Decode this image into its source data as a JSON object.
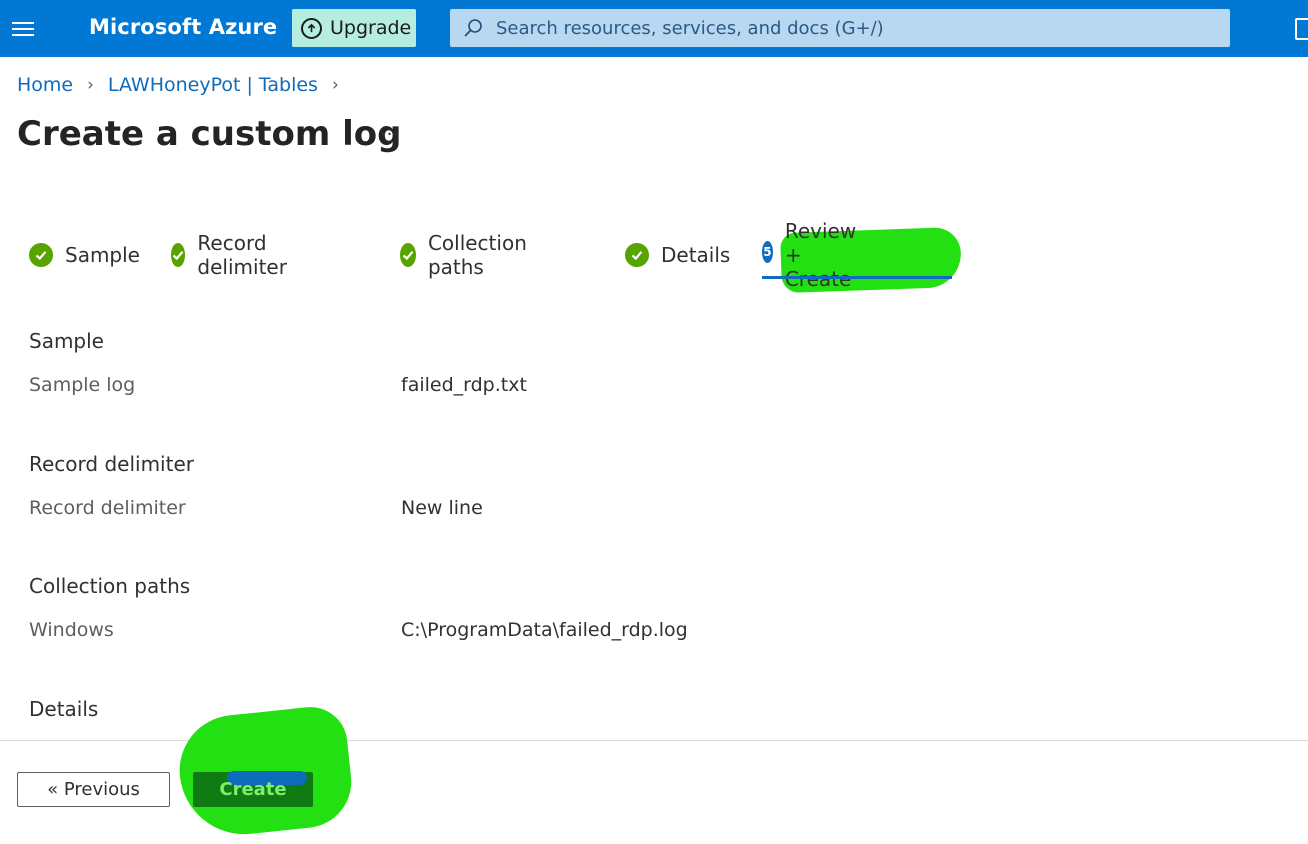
{
  "topbar": {
    "brand": "Microsoft Azure",
    "upgrade_label": "Upgrade",
    "search_placeholder": "Search resources, services, and docs (G+/)"
  },
  "breadcrumb": {
    "items": [
      "Home",
      "LAWHoneyPot | Tables"
    ]
  },
  "page": {
    "title": "Create a custom log",
    "more": "···"
  },
  "steps": [
    {
      "label": "Sample",
      "status": "complete"
    },
    {
      "label": "Record delimiter",
      "status": "complete"
    },
    {
      "label": "Collection paths",
      "status": "complete"
    },
    {
      "label": "Details",
      "status": "complete"
    },
    {
      "label": "Review + Create",
      "status": "active",
      "number": "5"
    }
  ],
  "review": {
    "sample": {
      "heading": "Sample",
      "label": "Sample log",
      "value": "failed_rdp.txt"
    },
    "record_delimiter": {
      "heading": "Record delimiter",
      "label": "Record delimiter",
      "value": "New line"
    },
    "collection_paths": {
      "heading": "Collection paths",
      "label": "Windows",
      "value": "C:\\ProgramData\\failed_rdp.log"
    },
    "details": {
      "heading": "Details"
    }
  },
  "footer": {
    "previous_label": "« Previous",
    "create_label": "Create"
  },
  "colors": {
    "topbar": "#0078d4",
    "check": "#57a300",
    "accent": "#0f6cbd",
    "annotation_highlight": "#22e012"
  }
}
